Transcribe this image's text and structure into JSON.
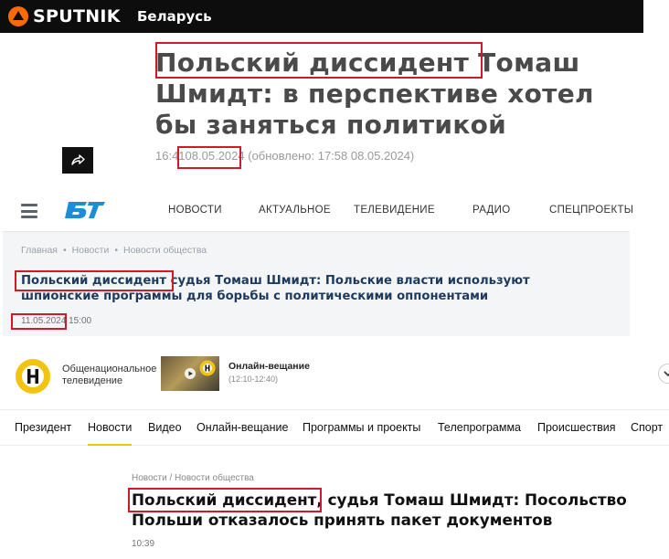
{
  "sputnik": {
    "brand": "SPUTNIK",
    "region": "Беларусь",
    "title": "Польский диссидент Томаш Шмидт: в перспективе хотел бы заняться политикой",
    "time": "16:41",
    "date": "08.05.2024",
    "updated": "(обновлено: 17:58 08.05.2024)",
    "share_icon": "share-icon"
  },
  "bt": {
    "logo_text": "БТ",
    "nav": [
      "НОВОСТИ",
      "АКТУАЛЬНОЕ",
      "ТЕЛЕВИДЕНИЕ",
      "РАДИО",
      "СПЕЦПРОЕКТЫ"
    ],
    "breadcrumbs": [
      "Главная",
      "Новости",
      "Новости общества"
    ],
    "title": "Польский диссидент судья Томаш Шмидт: Польские власти используют шпионские программы для борьбы с политическими оппонентами",
    "date": "11.05.2024",
    "time": "15:00"
  },
  "ont": {
    "brand_line1": "Общенациональное",
    "brand_line2": "телевидение",
    "live_label": "Онлайн-вещание",
    "live_time": "(12:10-12:40)",
    "menu": [
      "Президент",
      "Новости",
      "Видео",
      "Онлайн-вещание",
      "Программы и проекты",
      "Телепрограмма",
      "Происшествия",
      "Спорт"
    ],
    "active_menu": "Новости",
    "breadcrumbs": "Новости / Новости общества",
    "title": "Польский диссидент, судья Томаш Шмидт: Посольство Польши отказалось принять пакет документов",
    "time": "10:39",
    "accent_color": "#f2c40f"
  },
  "highlight_color": "#d01a2a"
}
